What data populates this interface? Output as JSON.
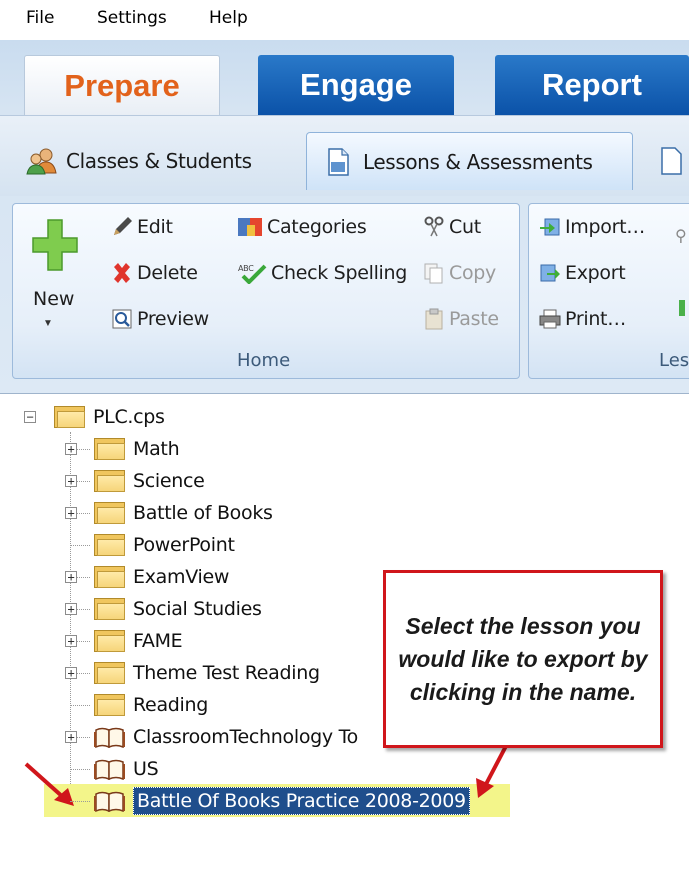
{
  "menu": [
    "File",
    "Settings",
    "Help"
  ],
  "main_tabs": [
    "Prepare",
    "Engage",
    "Report"
  ],
  "sub_tabs": [
    "Classes & Students",
    "Lessons & Assessments"
  ],
  "ribbon": {
    "new_label": "New",
    "home": {
      "edit": "Edit",
      "delete": "Delete",
      "preview": "Preview",
      "categories": "Categories",
      "check_spelling": "Check Spelling",
      "cut": "Cut",
      "copy": "Copy",
      "paste": "Paste",
      "group_label": "Home"
    },
    "lessons": {
      "import": "Import…",
      "export": "Export",
      "print": "Print…",
      "group_label": "Les"
    }
  },
  "tree": {
    "root": "PLC.cps",
    "items": [
      {
        "label": "Math",
        "icon": "folder-icon",
        "expandable": true
      },
      {
        "label": "Science",
        "icon": "folder-icon",
        "expandable": true
      },
      {
        "label": "Battle of Books",
        "icon": "folder-icon",
        "expandable": true
      },
      {
        "label": "PowerPoint",
        "icon": "folder-icon",
        "expandable": false
      },
      {
        "label": "ExamView",
        "icon": "folder-icon",
        "expandable": true
      },
      {
        "label": "Social Studies",
        "icon": "folder-icon",
        "expandable": true
      },
      {
        "label": "FAME",
        "icon": "folder-icon",
        "expandable": true
      },
      {
        "label": "Theme Test Reading",
        "icon": "folder-icon",
        "expandable": true
      },
      {
        "label": "Reading",
        "icon": "folder-icon",
        "expandable": false
      },
      {
        "label": "ClassroomTechnology To",
        "icon": "book-icon",
        "expandable": true
      },
      {
        "label": "US",
        "icon": "book-icon",
        "expandable": false
      },
      {
        "label": "Battle Of Books Practice 2008-2009",
        "icon": "book-icon",
        "expandable": false,
        "selected": true
      }
    ]
  },
  "callout": {
    "text": "Select the lesson you would like to export by clicking in the name."
  },
  "colors": {
    "prepare_tab_text": "#e2621b",
    "tab_blue": "#0b52a8",
    "selection_bg": "#1f4e8c",
    "highlight": "#f3f58a",
    "callout_border": "#d0161b",
    "arrow": "#d0161b"
  }
}
